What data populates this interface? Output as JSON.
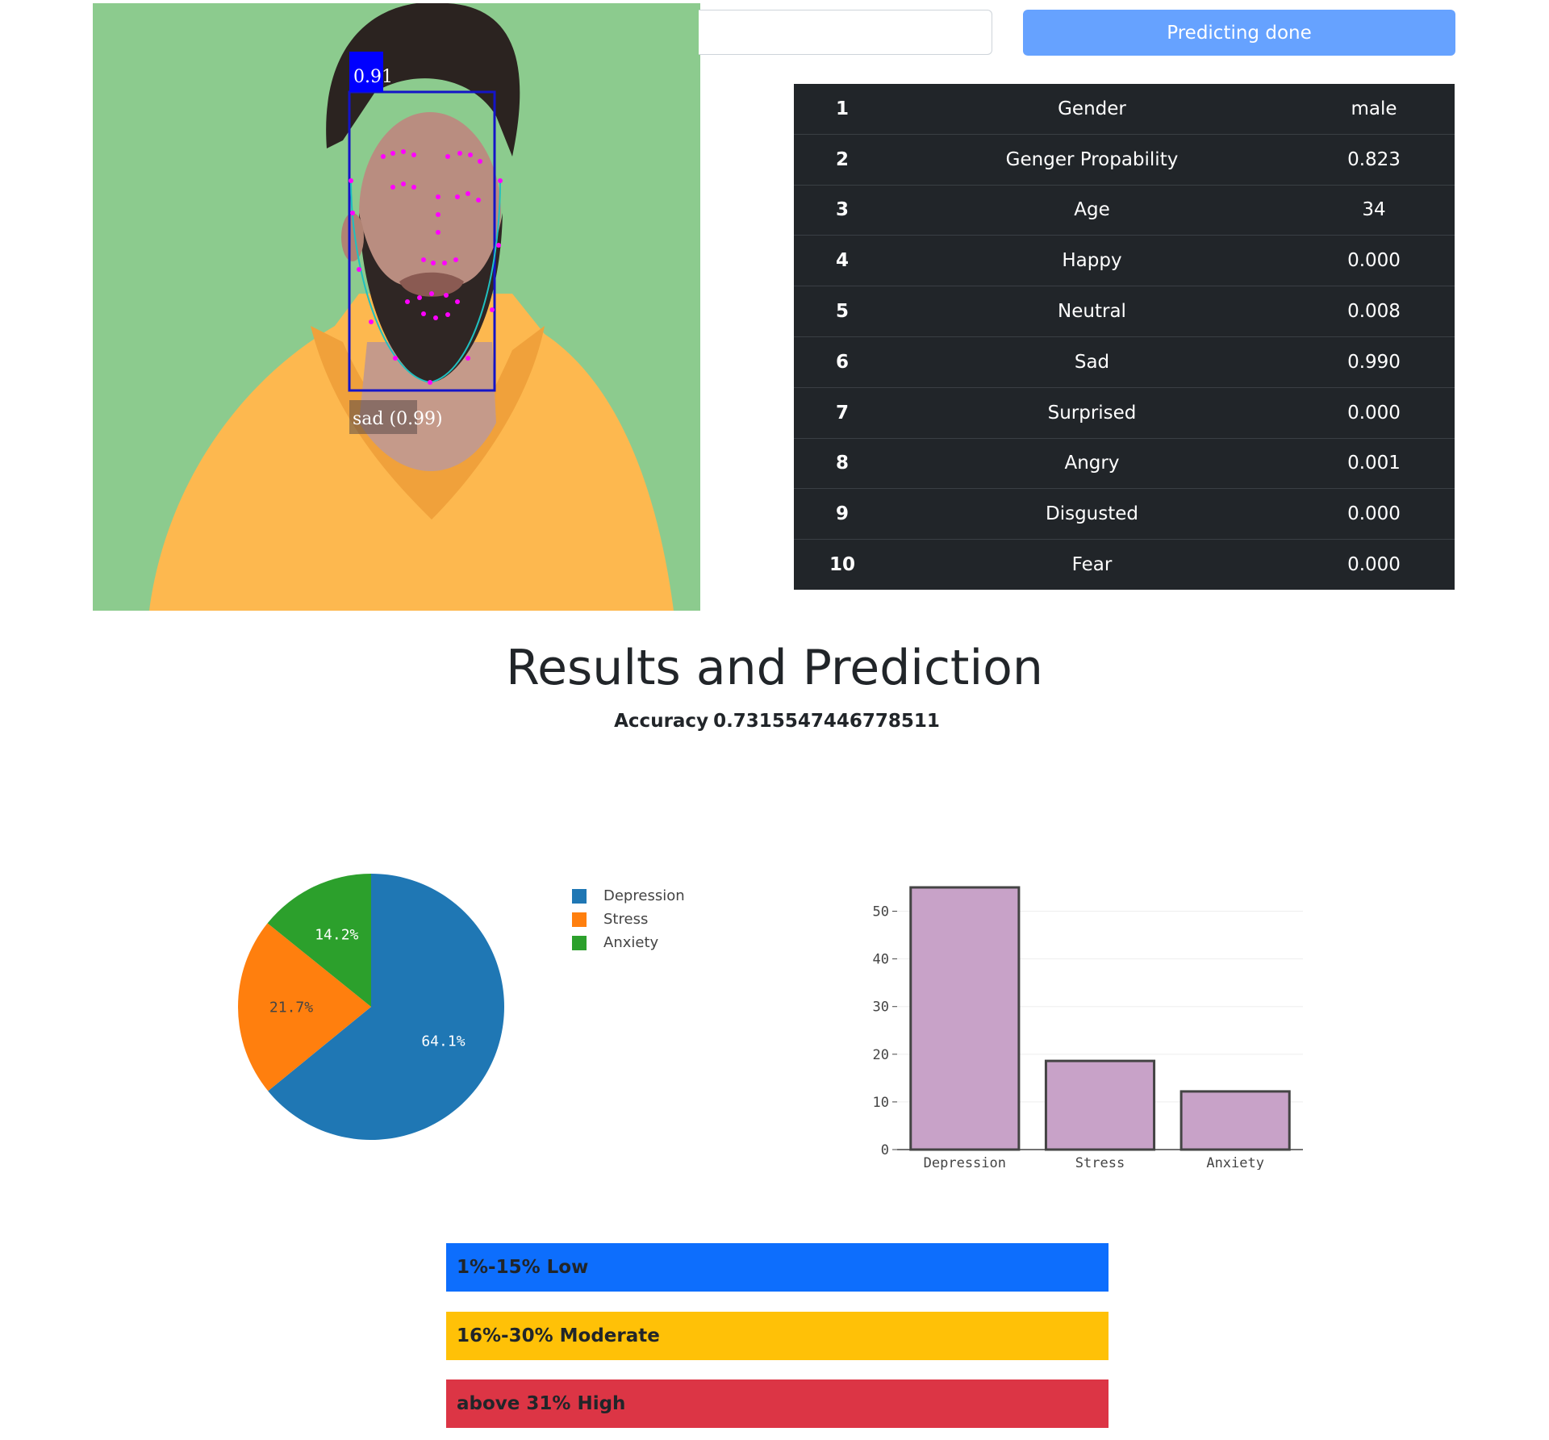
{
  "header": {
    "predict_button_label": "Predicting done"
  },
  "image": {
    "face_score": "0.91",
    "emotion_label": "sad (0.99)"
  },
  "results_table": [
    {
      "index": "1",
      "name": "Gender",
      "value": "male"
    },
    {
      "index": "2",
      "name": "Genger Propability",
      "value": "0.823"
    },
    {
      "index": "3",
      "name": "Age",
      "value": "34"
    },
    {
      "index": "4",
      "name": "Happy",
      "value": "0.000"
    },
    {
      "index": "5",
      "name": "Neutral",
      "value": "0.008"
    },
    {
      "index": "6",
      "name": "Sad",
      "value": "0.990"
    },
    {
      "index": "7",
      "name": "Surprised",
      "value": "0.000"
    },
    {
      "index": "8",
      "name": "Angry",
      "value": "0.001"
    },
    {
      "index": "9",
      "name": "Disgusted",
      "value": "0.000"
    },
    {
      "index": "10",
      "name": "Fear",
      "value": "0.000"
    }
  ],
  "results": {
    "heading": "Results and Prediction",
    "accuracy_label": "Accuracy",
    "accuracy_value": "0.7315547446778511"
  },
  "chart_data": [
    {
      "type": "pie",
      "categories": [
        "Depression",
        "Stress",
        "Anxiety"
      ],
      "values": [
        64.1,
        21.7,
        14.2
      ],
      "value_labels": [
        "64.1%",
        "21.7%",
        "14.2%"
      ],
      "colors": [
        "#1f77b4",
        "#ff7f0e",
        "#2ca02c"
      ],
      "legend": "right"
    },
    {
      "type": "bar",
      "categories": [
        "Depression",
        "Stress",
        "Anxiety"
      ],
      "values": [
        55,
        18.6,
        12.2
      ],
      "ylim": [
        0,
        55
      ],
      "yticks": [
        0,
        10,
        20,
        30,
        40,
        50
      ],
      "bar_color": "#c8a2c8",
      "bar_edge_color": "#444444",
      "grid": true
    }
  ],
  "levels": [
    {
      "label": "1%-15% Low",
      "color": "#0d6efd"
    },
    {
      "label": "16%-30% Moderate",
      "color": "#ffc107"
    },
    {
      "label": "above 31% High",
      "color": "#dc3545"
    }
  ]
}
